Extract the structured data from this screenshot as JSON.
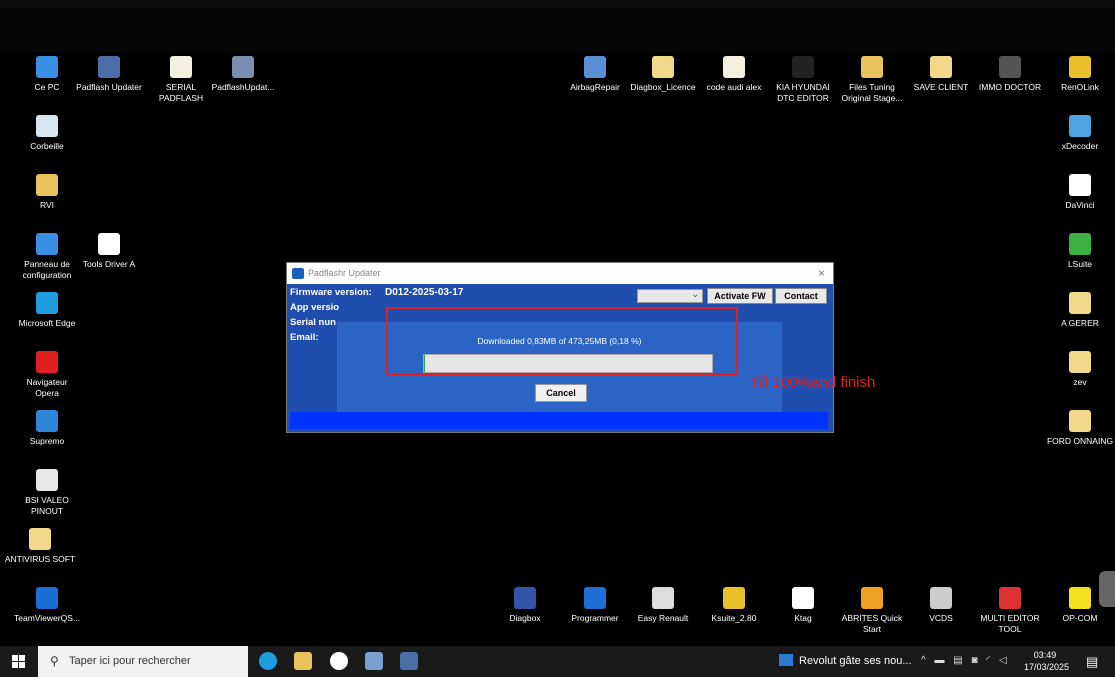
{
  "desktop_icons": [
    {
      "label": "Ce PC",
      "icon": "computer-icon",
      "color": "#3a8ee6"
    },
    {
      "label": "Padflash Updater",
      "icon": "padflash-icon",
      "color": "#4a6fa8"
    },
    {
      "label": "SERIAL\nPADFLASH",
      "icon": "document-icon",
      "color": "#f3f0e0"
    },
    {
      "label": "PadflashUpdat...",
      "icon": "installer-icon",
      "color": "#7a8fb0"
    },
    {
      "label": "AirbagRepair",
      "icon": "airbag-icon",
      "color": "#5a8fd6"
    },
    {
      "label": "Diagbox_Licence",
      "icon": "folder-doc-icon",
      "color": "#f0d98a"
    },
    {
      "label": "code audi alex",
      "icon": "document-icon",
      "color": "#f3f0e0"
    },
    {
      "label": "KIA HYUNDAI\nDTC EDITOR",
      "icon": "app-icon",
      "color": "#222222"
    },
    {
      "label": "Files Tuning\nOriginal Stage...",
      "icon": "folder-icon",
      "color": "#e9c25b"
    },
    {
      "label": "SAVE CLIENT",
      "icon": "folder-doc-icon",
      "color": "#f0d98a"
    },
    {
      "label": "IMMO DOCTOR",
      "icon": "chip-icon",
      "color": "#555555"
    },
    {
      "label": "RenOLink",
      "icon": "renolink-icon",
      "color": "#e8c12a"
    },
    {
      "label": "Corbeille",
      "icon": "recycle-bin-icon",
      "color": "#d8e6f0"
    },
    {
      "label": "xDecoder",
      "icon": "xdecoder-icon",
      "color": "#4fa3e0"
    },
    {
      "label": "RVI",
      "icon": "folder-icon",
      "color": "#e9c25b"
    },
    {
      "label": "DaVinci",
      "icon": "davinci-icon",
      "color": "#ffffff"
    },
    {
      "label": "Panneau de\nconfiguration",
      "icon": "control-panel-icon",
      "color": "#3a8ee6"
    },
    {
      "label": "Tools Driver A",
      "icon": "tools-driver-icon",
      "color": "#ffffff"
    },
    {
      "label": "LSuite",
      "icon": "lsuite-icon",
      "color": "#3cb043"
    },
    {
      "label": "Microsoft Edge",
      "icon": "edge-icon",
      "color": "#1f9de0"
    },
    {
      "label": "A GERER",
      "icon": "folder-doc-icon",
      "color": "#f0d98a"
    },
    {
      "label": "Navigateur\nOpera",
      "icon": "opera-icon",
      "color": "#e0201e"
    },
    {
      "label": "zev",
      "icon": "folder-doc-icon",
      "color": "#f0d98a"
    },
    {
      "label": "Supremo",
      "icon": "supremo-icon",
      "color": "#2f86d8"
    },
    {
      "label": "FORD ONNAING",
      "icon": "folder-doc-icon",
      "color": "#f0d98a"
    },
    {
      "label": "BSI VALEO\nPINOUT",
      "icon": "window-icon",
      "color": "#e8e8e8"
    },
    {
      "label": "ANTIVIRUS SOFT",
      "icon": "folder-doc-icon",
      "color": "#f0d98a"
    },
    {
      "label": "TeamViewerQS...",
      "icon": "teamviewer-icon",
      "color": "#1a6fd6"
    },
    {
      "label": "Diagbox",
      "icon": "diagbox-icon",
      "color": "#3355aa"
    },
    {
      "label": "Programmer",
      "icon": "programmer-icon",
      "color": "#1e6ed6"
    },
    {
      "label": "Easy Renault",
      "icon": "easy-renault-icon",
      "color": "#dddddd"
    },
    {
      "label": "Ksuite_2.80",
      "icon": "ksuite-icon",
      "color": "#e8c12a"
    },
    {
      "label": "Ktag",
      "icon": "ktag-icon",
      "color": "#ffffff"
    },
    {
      "label": "ABRITES Quick\nStart",
      "icon": "abrites-icon",
      "color": "#f0a020"
    },
    {
      "label": "VCDS",
      "icon": "vcds-icon",
      "color": "#cccccc"
    },
    {
      "label": "MULTI EDITOR\nTOOL",
      "icon": "multi-editor-icon",
      "color": "#dd3333"
    },
    {
      "label": "OP-COM",
      "icon": "opcom-icon",
      "color": "#f5e020"
    }
  ],
  "dialog": {
    "title": "Padflashr Updater",
    "close": "×",
    "firmware_label": "Firmware version:",
    "firmware_value": "D012-2025-03-17",
    "app_label": "App versio",
    "serial_label": "Serial nun",
    "email_label": "Email:",
    "activate_btn": "Activate FW",
    "contact_btn": "Contact",
    "combo_chevron": "⌄",
    "download_text": "Downloaded 0,83MB of 473,25MB (0,18 %)",
    "progress_percent": 0.18,
    "cancel_btn": "Cancel"
  },
  "annotation": "Till 100%and finish",
  "annotation_color": "#e0201e",
  "taskbar": {
    "search_placeholder": "Taper ici pour rechercher",
    "search_icon": "⚲",
    "news": "Revolut gâte ses nou...",
    "tray": "^ ▬ ▤ ◙ ◜ ◁",
    "time": "03:49",
    "date": "17/03/2025",
    "notif": "▤"
  }
}
